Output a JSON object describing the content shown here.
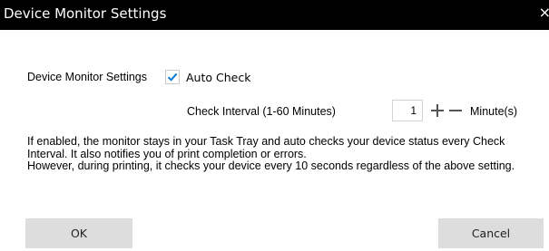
{
  "window": {
    "title": "Device Monitor Settings",
    "close_glyph": "×"
  },
  "settings": {
    "label": "Device Monitor Settings",
    "auto_check": {
      "label": "Auto Check",
      "checked": true
    },
    "interval": {
      "label": "Check Interval (1-60 Minutes)",
      "value": "1",
      "unit": "Minute(s)"
    }
  },
  "description": {
    "line1": "If enabled, the monitor stays in your Task Tray and auto checks your device status every Check Interval. It also notifies you of print completion or errors.",
    "line2": "However, during printing, it checks your device every 10 seconds regardless of the above setting."
  },
  "buttons": {
    "ok": "OK",
    "cancel": "Cancel"
  },
  "colors": {
    "titlebar": "#000000",
    "checkmark": "#0078d7",
    "button_bg": "#dddddd"
  }
}
